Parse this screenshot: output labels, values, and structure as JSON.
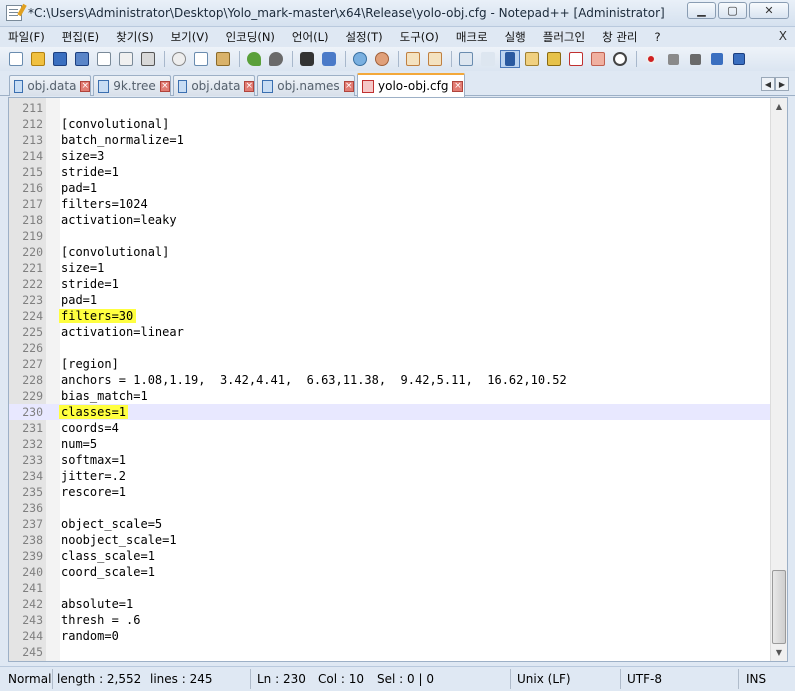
{
  "window": {
    "title": "*C:\\Users\\Administrator\\Desktop\\Yolo_mark-master\\x64\\Release\\yolo-obj.cfg - Notepad++ [Administrator]",
    "minimize_label": "▁",
    "maximize_label": "▢",
    "close_label": "✕"
  },
  "menu": {
    "items": [
      "파일(F)",
      "편집(E)",
      "찾기(S)",
      "보기(V)",
      "인코딩(N)",
      "언어(L)",
      "설정(T)",
      "도구(O)",
      "매크로",
      "실행",
      "플러그인",
      "창 관리",
      "?"
    ],
    "close_label": "X"
  },
  "tabs": [
    {
      "label": "obj.data",
      "icon": "file-icon",
      "active": false
    },
    {
      "label": "9k.tree",
      "icon": "file-icon",
      "active": false
    },
    {
      "label": "obj.data",
      "icon": "file-icon",
      "active": false
    },
    {
      "label": "obj.names",
      "icon": "file-icon",
      "active": false
    },
    {
      "label": "yolo-obj.cfg",
      "icon": "unsaved-file-icon",
      "active": true
    }
  ],
  "editor": {
    "lines": [
      {
        "n": "211",
        "text": ""
      },
      {
        "n": "212",
        "text": "[convolutional]"
      },
      {
        "n": "213",
        "text": "batch_normalize=1"
      },
      {
        "n": "214",
        "text": "size=3"
      },
      {
        "n": "215",
        "text": "stride=1"
      },
      {
        "n": "216",
        "text": "pad=1"
      },
      {
        "n": "217",
        "text": "filters=1024"
      },
      {
        "n": "218",
        "text": "activation=leaky"
      },
      {
        "n": "219",
        "text": ""
      },
      {
        "n": "220",
        "text": "[convolutional]"
      },
      {
        "n": "221",
        "text": "size=1"
      },
      {
        "n": "222",
        "text": "stride=1"
      },
      {
        "n": "223",
        "text": "pad=1"
      },
      {
        "n": "224",
        "text": "filters=30"
      },
      {
        "n": "225",
        "text": "activation=linear"
      },
      {
        "n": "226",
        "text": ""
      },
      {
        "n": "227",
        "text": "[region]"
      },
      {
        "n": "228",
        "text": "anchors = 1.08,1.19,  3.42,4.41,  6.63,11.38,  9.42,5.11,  16.62,10.52"
      },
      {
        "n": "229",
        "text": "bias_match=1"
      },
      {
        "n": "230",
        "text": "classes=1"
      },
      {
        "n": "231",
        "text": "coords=4"
      },
      {
        "n": "232",
        "text": "num=5"
      },
      {
        "n": "233",
        "text": "softmax=1"
      },
      {
        "n": "234",
        "text": "jitter=.2"
      },
      {
        "n": "235",
        "text": "rescore=1"
      },
      {
        "n": "236",
        "text": ""
      },
      {
        "n": "237",
        "text": "object_scale=5"
      },
      {
        "n": "238",
        "text": "noobject_scale=1"
      },
      {
        "n": "239",
        "text": "class_scale=1"
      },
      {
        "n": "240",
        "text": "coord_scale=1"
      },
      {
        "n": "241",
        "text": ""
      },
      {
        "n": "242",
        "text": "absolute=1"
      },
      {
        "n": "243",
        "text": "thresh = .6"
      },
      {
        "n": "244",
        "text": "random=0"
      },
      {
        "n": "245",
        "text": ""
      }
    ],
    "current_line": "230",
    "highlighted_lines": [
      "224",
      "230"
    ],
    "highlight_color": "#ffff40",
    "current_line_color": "#e8e8ff"
  },
  "status": {
    "mode": "Normal",
    "length": "length : 2,552",
    "lines": "lines : 245",
    "ln": "Ln : 230",
    "col": "Col : 10",
    "sel": "Sel : 0 | 0",
    "eol": "Unix (LF)",
    "encoding": "UTF-8",
    "insert": "INS"
  },
  "toolbar_icons": [
    "new-file-icon",
    "open-file-icon",
    "save-icon",
    "save-all-icon",
    "close-icon",
    "close-all-icon",
    "print-icon",
    "cut-icon",
    "copy-icon",
    "paste-icon",
    "undo-icon",
    "redo-icon",
    "find-icon",
    "replace-icon",
    "zoom-in-icon",
    "zoom-out-icon",
    "sync-vertical-icon",
    "sync-horizontal-icon",
    "word-wrap-icon",
    "show-all-chars-icon",
    "indent-guide-icon",
    "doc-map-icon",
    "function-list-icon",
    "folder-workspace-icon",
    "monitoring-icon",
    "record-macro-icon",
    "stop-macro-icon",
    "play-macro-icon",
    "play-multiple-icon",
    "save-macro-icon"
  ]
}
